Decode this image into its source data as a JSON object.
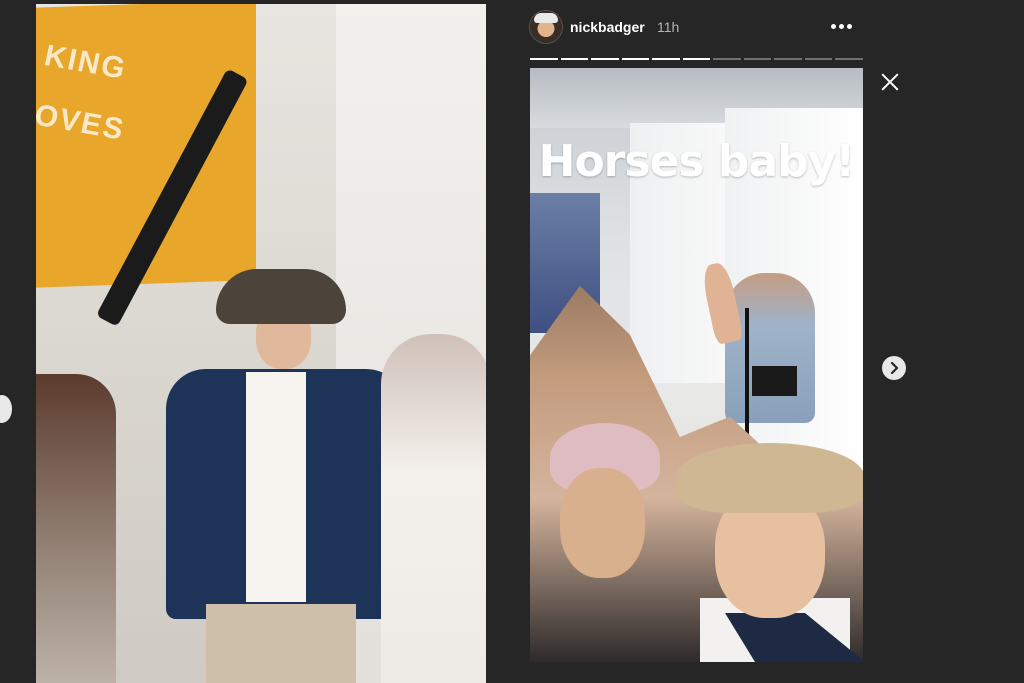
{
  "stories": {
    "previous": {
      "sign_text_line1": "KING",
      "sign_text_line2": "OVES"
    },
    "current": {
      "username": "nickbadger",
      "time_ago": "11h",
      "caption": "Horses baby!",
      "progress_total": 11,
      "progress_done": 6
    }
  },
  "icons": {
    "avatar": "profile-avatar",
    "more": "more-options-icon",
    "close": "close-icon",
    "next": "chevron-right-icon",
    "prev": "chevron-left-icon"
  },
  "colors": {
    "background": "#262626",
    "text": "#ffffff",
    "muted_text": "#b5b5b5",
    "sign": "#e8a62a"
  }
}
